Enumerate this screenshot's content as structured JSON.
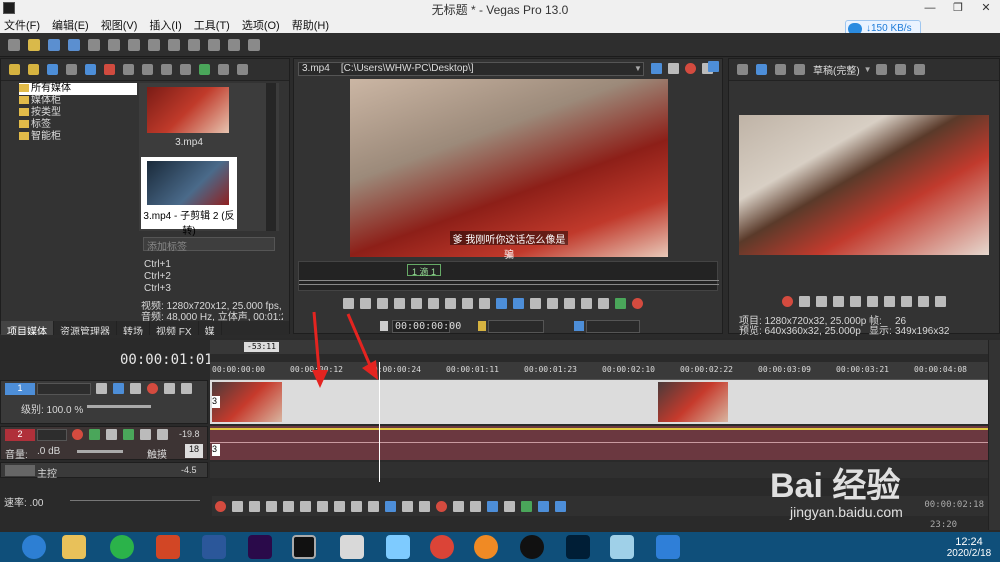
{
  "window": {
    "title": "无标题 * - Vegas Pro 13.0",
    "min": "—",
    "max": "❐",
    "close": "✕"
  },
  "menu": [
    "文件(F)",
    "编辑(E)",
    "视图(V)",
    "插入(I)",
    "工具(T)",
    "选项(O)",
    "帮助(H)"
  ],
  "network": {
    "speed": "↓150 KB/s"
  },
  "explorer": {
    "tree": [
      "所有媒体",
      "媒体柜",
      "按类型",
      "标签",
      "智能柜"
    ],
    "media": [
      {
        "name": "3.mp4"
      },
      {
        "name": "3.mp4 - 子剪辑 2 (反转)"
      }
    ],
    "tag_placeholder": "添加标签",
    "shortcuts": [
      "Ctrl+1",
      "Ctrl+2",
      "Ctrl+3"
    ],
    "info_video": "视频: 1280x720x12, 25.000 fps, 0",
    "info_audio": "音频: 48,000 Hz, 立体声, 00:01:2",
    "tabs": [
      "项目媒体",
      "资源管理器",
      "转场",
      "视频 FX",
      "媒"
    ]
  },
  "trimmer": {
    "path": "3.mp4    [C:\\Users\\WHW-PC\\Desktop\\]",
    "subtitle": "爹 我刚听你这话怎么像是骗",
    "region_label": "1 滴 1",
    "timecode": "00:00:00:00"
  },
  "preview": {
    "quality": "草稿(完整)",
    "project": "项目: 1280x720x32, 25.000p",
    "preview": "预览: 640x360x32, 25.000p",
    "frame_label": "帧:",
    "frame": "26",
    "display_label": "显示:",
    "display": "349x196x32"
  },
  "timeline": {
    "current_time": "00:00:01:01",
    "selection": "-53:11",
    "ruler": [
      "00:00:00:00",
      "00:00:00:12",
      "00:00:00:24",
      "00:00:01:11",
      "00:00:01:23",
      "00:00:02:10",
      "00:00:02:22",
      "00:00:03:09",
      "00:00:03:21",
      "00:00:04:08"
    ],
    "video_track": {
      "number": "1",
      "level": "级别: 100.0 %",
      "clip_num": "3"
    },
    "audio_track": {
      "number": "2",
      "volume": "音量:",
      "volume_val": ".0 dB",
      "pan": "触摸",
      "meter": "-19.8",
      "meter2": "18",
      "clip_num": "3"
    },
    "master": {
      "label": "主控",
      "val": "-4.5"
    },
    "rate": "速率: .00",
    "end_time": "00:00:02:18",
    "end_time2": "23:20"
  },
  "taskbar": {
    "time": "12:24",
    "date": "2020/2/18"
  },
  "watermark": {
    "brand": "Bai 经验",
    "url": "jingyan.baidu.com"
  }
}
